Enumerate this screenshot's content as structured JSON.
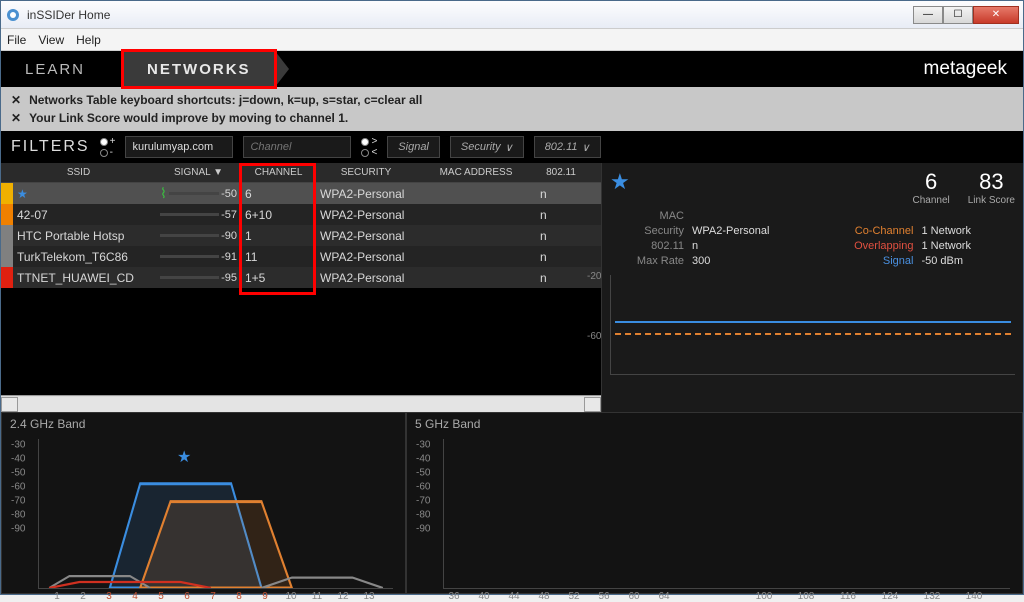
{
  "window": {
    "title": "inSSIDer Home"
  },
  "menu": {
    "file": "File",
    "view": "View",
    "help": "Help"
  },
  "nav": {
    "learn": "LEARN",
    "networks": "NETWORKS",
    "brand_meta": "meta",
    "brand_geek": "geek"
  },
  "tips": {
    "t1": "Networks Table keyboard shortcuts: j=down, k=up, s=star, c=clear all",
    "t2": "Your Link Score would improve by moving to channel 1."
  },
  "filters": {
    "label": "FILTERS",
    "ssid_value": "kurulumyap.com",
    "channel_placeholder": "Channel",
    "signal": "Signal",
    "security": "Security",
    "dot11": "802.11",
    "plus": "+",
    "minus": "-",
    "gt": ">",
    "lt": "<"
  },
  "table": {
    "headers": {
      "ssid": "SSID",
      "signal": "SIGNAL  ▼",
      "channel": "CHANNEL",
      "security": "SECURITY",
      "mac": "MAC ADDRESS",
      "dot11": "802.11"
    },
    "rows": [
      {
        "color": "#f0b000",
        "starred": true,
        "ssid": "",
        "signal": -50,
        "sigcolor": "#3ac040",
        "sigpct": 80,
        "channel": "6",
        "security": "WPA2-Personal",
        "mac": "",
        "dot11": "n"
      },
      {
        "color": "#f08000",
        "starred": false,
        "ssid": "42-07",
        "signal": -57,
        "sigcolor": "#3ac040",
        "sigpct": 68,
        "channel": "6+10",
        "security": "WPA2-Personal",
        "mac": "",
        "dot11": "n"
      },
      {
        "color": "#808080",
        "starred": false,
        "ssid": "HTC Portable Hotsp",
        "signal": -90,
        "sigcolor": "#d03020",
        "sigpct": 12,
        "channel": "1",
        "security": "WPA2-Personal",
        "mac": "",
        "dot11": "n"
      },
      {
        "color": "#808080",
        "starred": false,
        "ssid": "TurkTelekom_T6C86",
        "signal": -91,
        "sigcolor": "#d03020",
        "sigpct": 10,
        "channel": "11",
        "security": "WPA2-Personal",
        "mac": "",
        "dot11": "n"
      },
      {
        "color": "#e02010",
        "starred": false,
        "ssid": "TTNET_HUAWEI_CD",
        "signal": -95,
        "sigcolor": "#d03020",
        "sigpct": 6,
        "channel": "1+5",
        "security": "WPA2-Personal",
        "mac": "",
        "dot11": "n"
      }
    ]
  },
  "detail": {
    "channel_val": "6",
    "channel_lbl": "Channel",
    "score_val": "83",
    "score_lbl": "Link Score",
    "mac_lbl": "MAC",
    "mac_val": "",
    "sec_lbl": "Security",
    "sec_val": "WPA2-Personal",
    "co_lbl": "Co-Channel",
    "co_val": "1 Network",
    "dot11_lbl": "802.11",
    "dot11_val": "n",
    "ov_lbl": "Overlapping",
    "ov_val": "1 Network",
    "rate_lbl": "Max Rate",
    "rate_val": "300",
    "sig_lbl": "Signal",
    "sig_val": "-50 dBm",
    "y20": "-20",
    "y60": "-60"
  },
  "band24": {
    "title": "2.4 GHz Band",
    "yticks": [
      "-30",
      "-40",
      "-50",
      "-60",
      "-70",
      "-80",
      "-90"
    ],
    "xticks": [
      "1",
      "2",
      "3",
      "4",
      "5",
      "6",
      "7",
      "8",
      "9",
      "10",
      "11",
      "12",
      "13"
    ]
  },
  "band5": {
    "title": "5 GHz Band",
    "yticks": [
      "-30",
      "-40",
      "-50",
      "-60",
      "-70",
      "-80",
      "-90"
    ],
    "xticks_left": [
      "36",
      "40",
      "44",
      "48",
      "52",
      "56",
      "60",
      "64"
    ],
    "xticks_right": [
      "100",
      "108",
      "116",
      "124",
      "132",
      "140"
    ]
  }
}
